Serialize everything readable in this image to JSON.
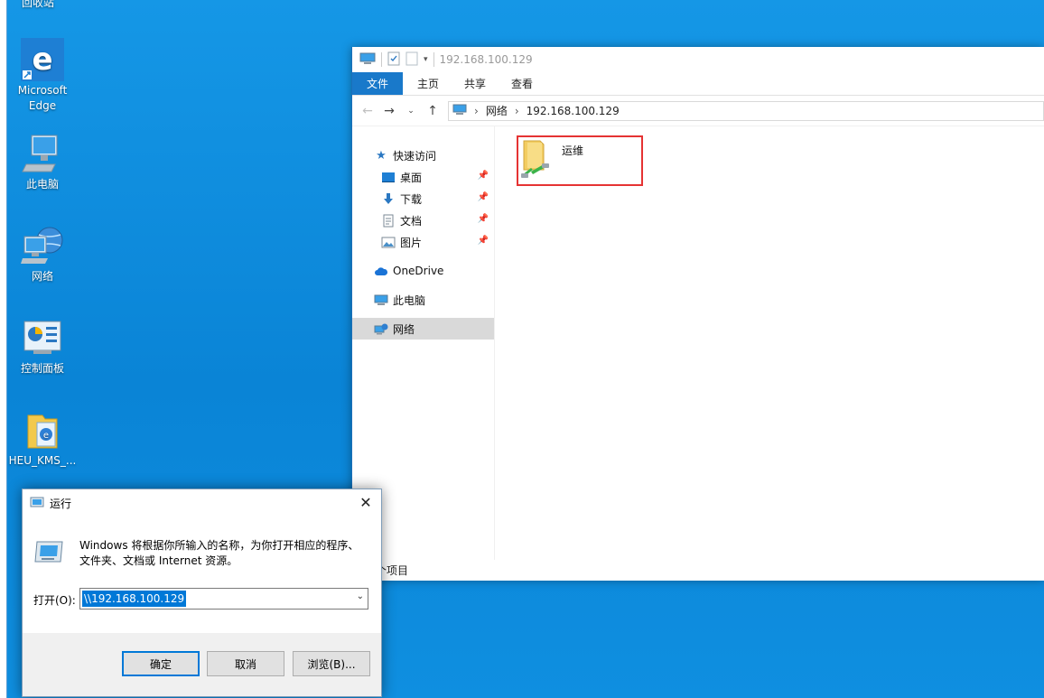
{
  "desktop": {
    "top_cut_label": "回收站",
    "icons": [
      {
        "label": "Microsoft Edge"
      },
      {
        "label": "此电脑"
      },
      {
        "label": "网络"
      },
      {
        "label": "控制面板"
      },
      {
        "label": "HEU_KMS_..."
      }
    ]
  },
  "explorer": {
    "title": "192.168.100.129",
    "ribbon_tabs": [
      "文件",
      "主页",
      "共享",
      "查看"
    ],
    "address": {
      "crumb1": "网络",
      "crumb2": "192.168.100.129"
    },
    "nav": {
      "quick_access": "快速访问",
      "desktop": "桌面",
      "downloads": "下载",
      "documents": "文档",
      "pictures": "图片",
      "onedrive": "OneDrive",
      "this_pc": "此电脑",
      "network": "网络"
    },
    "folder": {
      "label": "运维"
    },
    "status": "个项目"
  },
  "run_dialog": {
    "title": "运行",
    "description": "Windows 将根据你所输入的名称，为你打开相应的程序、文件夹、文档或 Internet 资源。",
    "open_label": "打开(O):",
    "input_value": "\\\\192.168.100.129",
    "ok_label": "确定",
    "cancel_label": "取消",
    "browse_label": "浏览(B)..."
  }
}
